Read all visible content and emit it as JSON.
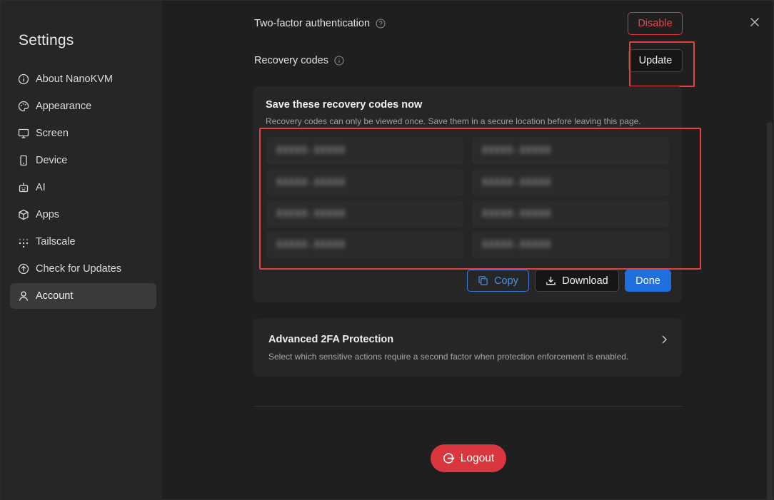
{
  "sidebar": {
    "title": "Settings",
    "items": [
      {
        "label": "About NanoKVM",
        "icon": "info-icon"
      },
      {
        "label": "Appearance",
        "icon": "palette-icon"
      },
      {
        "label": "Screen",
        "icon": "monitor-icon"
      },
      {
        "label": "Device",
        "icon": "phone-icon"
      },
      {
        "label": "AI",
        "icon": "robot-icon"
      },
      {
        "label": "Apps",
        "icon": "box-icon"
      },
      {
        "label": "Tailscale",
        "icon": "dots-grid-icon"
      },
      {
        "label": "Check for Updates",
        "icon": "arrow-up-circle-icon"
      },
      {
        "label": "Account",
        "icon": "user-icon",
        "active": true
      }
    ]
  },
  "account": {
    "two_factor_label": "Two-factor authentication",
    "disable_label": "Disable",
    "recovery_label": "Recovery codes",
    "update_label": "Update",
    "recovery_panel": {
      "title": "Save these recovery codes now",
      "subtitle": "Recovery codes can only be viewed once. Save them in a secure location before leaving this page.",
      "codes": [
        "XXXXX-XXXXX",
        "XXXXX-XXXXX",
        "XXXXX-XXXXX",
        "XXXXX-XXXXX",
        "XXXXX-XXXXX",
        "XXXXX-XXXXX",
        "XXXXX-XXXXX",
        "XXXXX-XXXXX"
      ],
      "copy_label": "Copy",
      "download_label": "Download",
      "done_label": "Done"
    },
    "advanced": {
      "title": "Advanced 2FA Protection",
      "description": "Select which sensitive actions require a second factor when protection enforcement is enabled."
    },
    "logout_label": "Logout"
  },
  "colors": {
    "accent_blue": "#1f6fde",
    "danger_red": "#d9363e",
    "highlight_red": "#e5413f"
  }
}
